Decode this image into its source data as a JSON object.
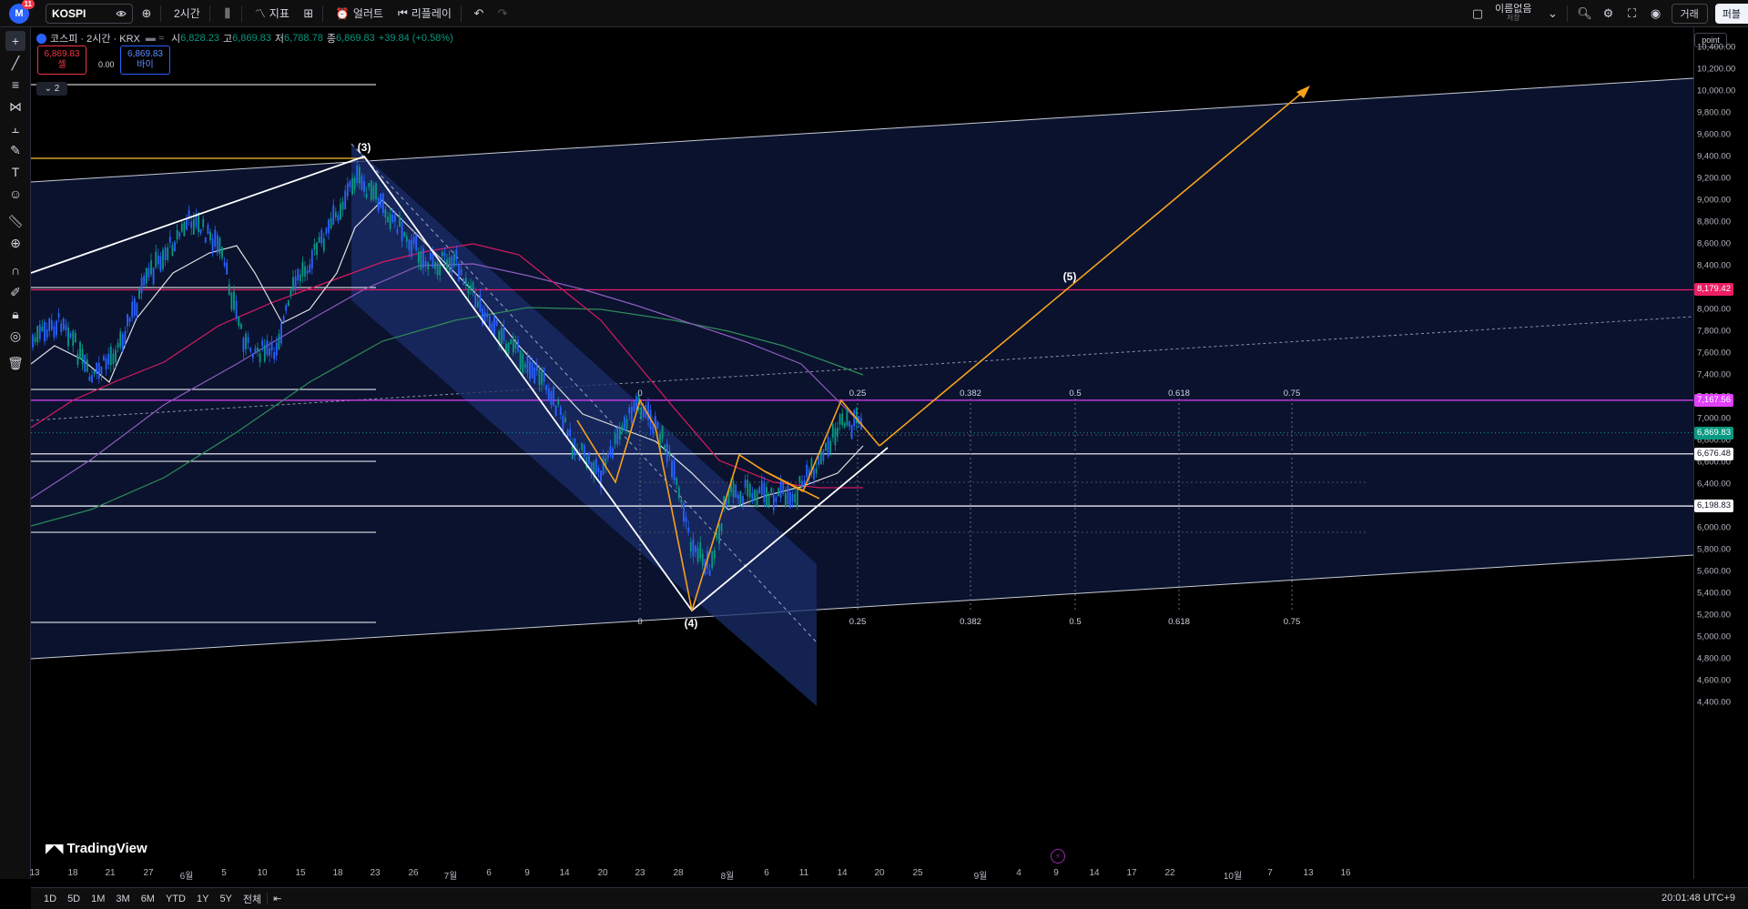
{
  "topbar": {
    "notification_count": "11",
    "symbol": "KOSPI",
    "interval": "2시간",
    "indicators_label": "지표",
    "alert_label": "얼러트",
    "replay_label": "리플레이",
    "layout_name": "이름없음",
    "layout_status": "저장",
    "trade_label": "거래",
    "publish_label": "퍼블"
  },
  "legend": {
    "name": "코스피 · 2시간 · KRX",
    "open_label": "시",
    "open": "6,828.23",
    "high_label": "고",
    "high": "6,869.83",
    "low_label": "저",
    "low": "6,788.78",
    "close_label": "종",
    "close": "6,869.83",
    "change": "+39.84 (+0.58%)",
    "sell_price": "6,869.83",
    "sell_label": "셀",
    "spread": "0.00",
    "buy_price": "6,869.83",
    "buy_label": "바이",
    "collapsed_count": "2"
  },
  "price_axis": {
    "unit": "point",
    "ticks": [
      "10,400.00",
      "10,200.00",
      "10,000.00",
      "9,800.00",
      "9,600.00",
      "9,400.00",
      "9,200.00",
      "9,000.00",
      "8,800.00",
      "8,600.00",
      "8,400.00",
      "8,200.00",
      "8,000.00",
      "7,800.00",
      "7,600.00",
      "7,400.00",
      "7,200.00",
      "7,000.00",
      "6,800.00",
      "6,600.00",
      "6,400.00",
      "6,200.00",
      "6,000.00",
      "5,800.00",
      "5,600.00",
      "5,400.00",
      "5,200.00",
      "5,000.00",
      "4,800.00",
      "4,600.00",
      "4,400.00"
    ],
    "labels": [
      {
        "value": "8,179.42",
        "bg": "#e91e63",
        "fg": "#ffffff"
      },
      {
        "value": "7,167.56",
        "bg": "#e040fb",
        "fg": "#ffffff"
      },
      {
        "value": "6,869.83",
        "bg": "#089981",
        "fg": "#ffffff"
      },
      {
        "value": "6,676.48",
        "bg": "#ffffff",
        "fg": "#131722"
      },
      {
        "value": "6,198.83",
        "bg": "#ffffff",
        "fg": "#131722"
      }
    ]
  },
  "time_axis": {
    "ticks": [
      "13",
      "18",
      "21",
      "27",
      "6월",
      "5",
      "10",
      "15",
      "18",
      "23",
      "26",
      "7월",
      "6",
      "9",
      "14",
      "20",
      "23",
      "28",
      "8월",
      "6",
      "11",
      "14",
      "20",
      "25",
      "9월",
      "4",
      "9",
      "14",
      "17",
      "22",
      "10월",
      "7",
      "13",
      "16"
    ]
  },
  "waves": [
    "(3)",
    "(4)",
    "(5)"
  ],
  "fib_levels": [
    "0",
    "0.25",
    "0.382",
    "0.5",
    "0.618",
    "0.75"
  ],
  "bottombar": {
    "ranges": [
      "1D",
      "5D",
      "1M",
      "3M",
      "6M",
      "YTD",
      "1Y",
      "5Y",
      "전체"
    ],
    "clock": "20:01:48 UTC+9"
  },
  "watermark": "TradingView",
  "colors": {
    "up": "#089981",
    "down": "#2962ff",
    "orange": "#f7a21b",
    "magenta_line": "#e91e63",
    "violet_line": "#e040fb",
    "channel_fill": "#0f1c45"
  },
  "chart_data": {
    "type": "candlestick",
    "symbol": "KOSPI",
    "interval": "2시간",
    "ylim": [
      4400,
      10400
    ],
    "anchors": [
      {
        "label": "(3)",
        "price": 9400
      },
      {
        "label": "(4)",
        "price": 5250
      },
      {
        "label": "(5)",
        "price": 8200
      }
    ],
    "horizontal_levels": [
      8179.42,
      7167.56,
      6676.48,
      6198.83
    ],
    "last_close": 6869.83
  }
}
